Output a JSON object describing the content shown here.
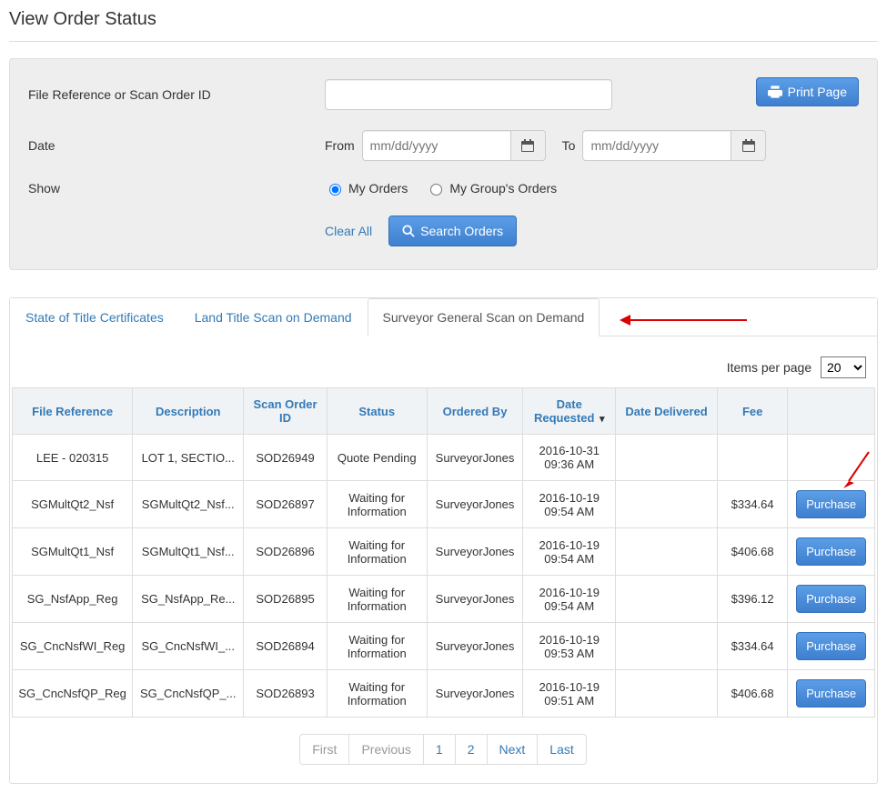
{
  "page": {
    "title": "View Order Status"
  },
  "search": {
    "label_ref": "File Reference or Scan Order ID",
    "label_date": "Date",
    "label_show": "Show",
    "from_label": "From",
    "to_label": "To",
    "date_placeholder": "mm/dd/yyyy",
    "radio_my": "My Orders",
    "radio_group": "My Group's Orders",
    "clear_label": "Clear All",
    "search_label": "Search Orders",
    "print_label": "Print Page"
  },
  "tabs": {
    "t0": "State of Title Certificates",
    "t1": "Land Title Scan on Demand",
    "t2": "Surveyor General Scan on Demand"
  },
  "per_page": {
    "label": "Items per page",
    "value": "20"
  },
  "columns": {
    "c0": "File Reference",
    "c1": "Description",
    "c2": "Scan Order ID",
    "c3": "Status",
    "c4": "Ordered By",
    "c5": "Date Requested",
    "c6": "Date Delivered",
    "c7": "Fee"
  },
  "rows": [
    {
      "ref": "LEE - 020315",
      "desc": "LOT 1, SECTIO...",
      "sid": "SOD26949",
      "status": "Quote Pending",
      "by": "SurveyorJones",
      "req": "2016-10-31 09:36 AM",
      "del": "",
      "fee": "",
      "action": ""
    },
    {
      "ref": "SGMultQt2_Nsf",
      "desc": "SGMultQt2_Nsf...",
      "sid": "SOD26897",
      "status": "Waiting for Information",
      "by": "SurveyorJones",
      "req": "2016-10-19 09:54 AM",
      "del": "",
      "fee": "$334.64",
      "action": "Purchase"
    },
    {
      "ref": "SGMultQt1_Nsf",
      "desc": "SGMultQt1_Nsf...",
      "sid": "SOD26896",
      "status": "Waiting for Information",
      "by": "SurveyorJones",
      "req": "2016-10-19 09:54 AM",
      "del": "",
      "fee": "$406.68",
      "action": "Purchase"
    },
    {
      "ref": "SG_NsfApp_Reg",
      "desc": "SG_NsfApp_Re...",
      "sid": "SOD26895",
      "status": "Waiting for Information",
      "by": "SurveyorJones",
      "req": "2016-10-19 09:54 AM",
      "del": "",
      "fee": "$396.12",
      "action": "Purchase"
    },
    {
      "ref": "SG_CncNsfWI_Reg",
      "desc": "SG_CncNsfWI_...",
      "sid": "SOD26894",
      "status": "Waiting for Information",
      "by": "SurveyorJones",
      "req": "2016-10-19 09:53 AM",
      "del": "",
      "fee": "$334.64",
      "action": "Purchase"
    },
    {
      "ref": "SG_CncNsfQP_Reg",
      "desc": "SG_CncNsfQP_...",
      "sid": "SOD26893",
      "status": "Waiting for Information",
      "by": "SurveyorJones",
      "req": "2016-10-19 09:51 AM",
      "del": "",
      "fee": "$406.68",
      "action": "Purchase"
    }
  ],
  "pager": {
    "first": "First",
    "prev": "Previous",
    "p1": "1",
    "p2": "2",
    "next": "Next",
    "last": "Last"
  }
}
